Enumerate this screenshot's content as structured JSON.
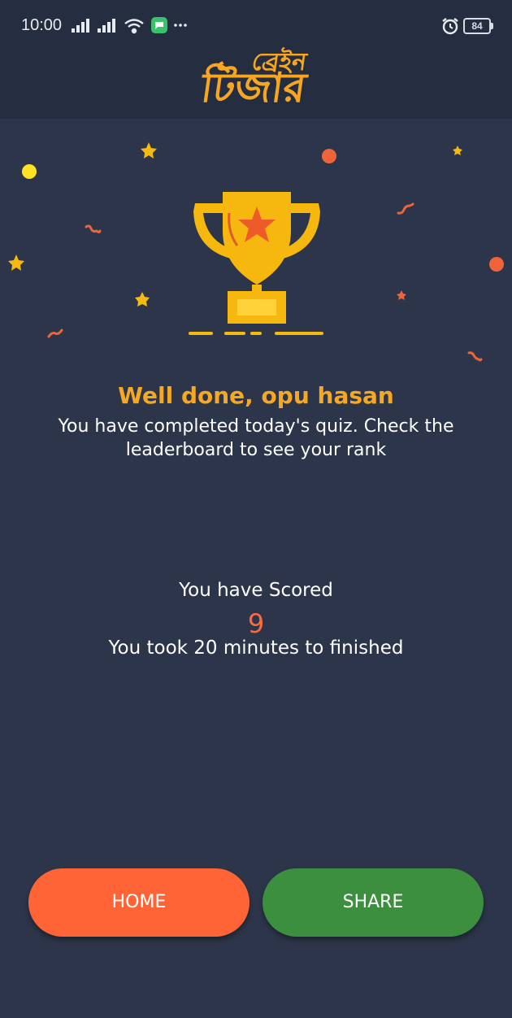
{
  "status_bar": {
    "time": "10:00",
    "battery": "84",
    "icons_left": [
      "signal-icon",
      "signal-icon",
      "wifi-icon",
      "message-icon",
      "more-dots-icon"
    ],
    "icons_right": [
      "alarm-icon",
      "battery-icon"
    ]
  },
  "header": {
    "logo_line1": "ব্রেইন",
    "logo_line2": "টিজার"
  },
  "result": {
    "title": "Well done, opu hasan",
    "message": "You have completed today's quiz. Check the leaderboard to see your rank",
    "scored_label": "You have Scored",
    "score": "9",
    "time_text": "You took 20 minutes to finished"
  },
  "buttons": {
    "home_label": "HOME",
    "share_label": "SHARE"
  },
  "colors": {
    "background": "#2c3549",
    "header": "#252e40",
    "accent_orange": "#f7a823",
    "score_red": "#ff6a3d",
    "home_button": "#ff6437",
    "share_button": "#3b8f3e"
  },
  "illustration": {
    "trophy_icon": "trophy-icon",
    "confetti": [
      "star-icon",
      "dot-icon",
      "squiggle-icon"
    ]
  }
}
